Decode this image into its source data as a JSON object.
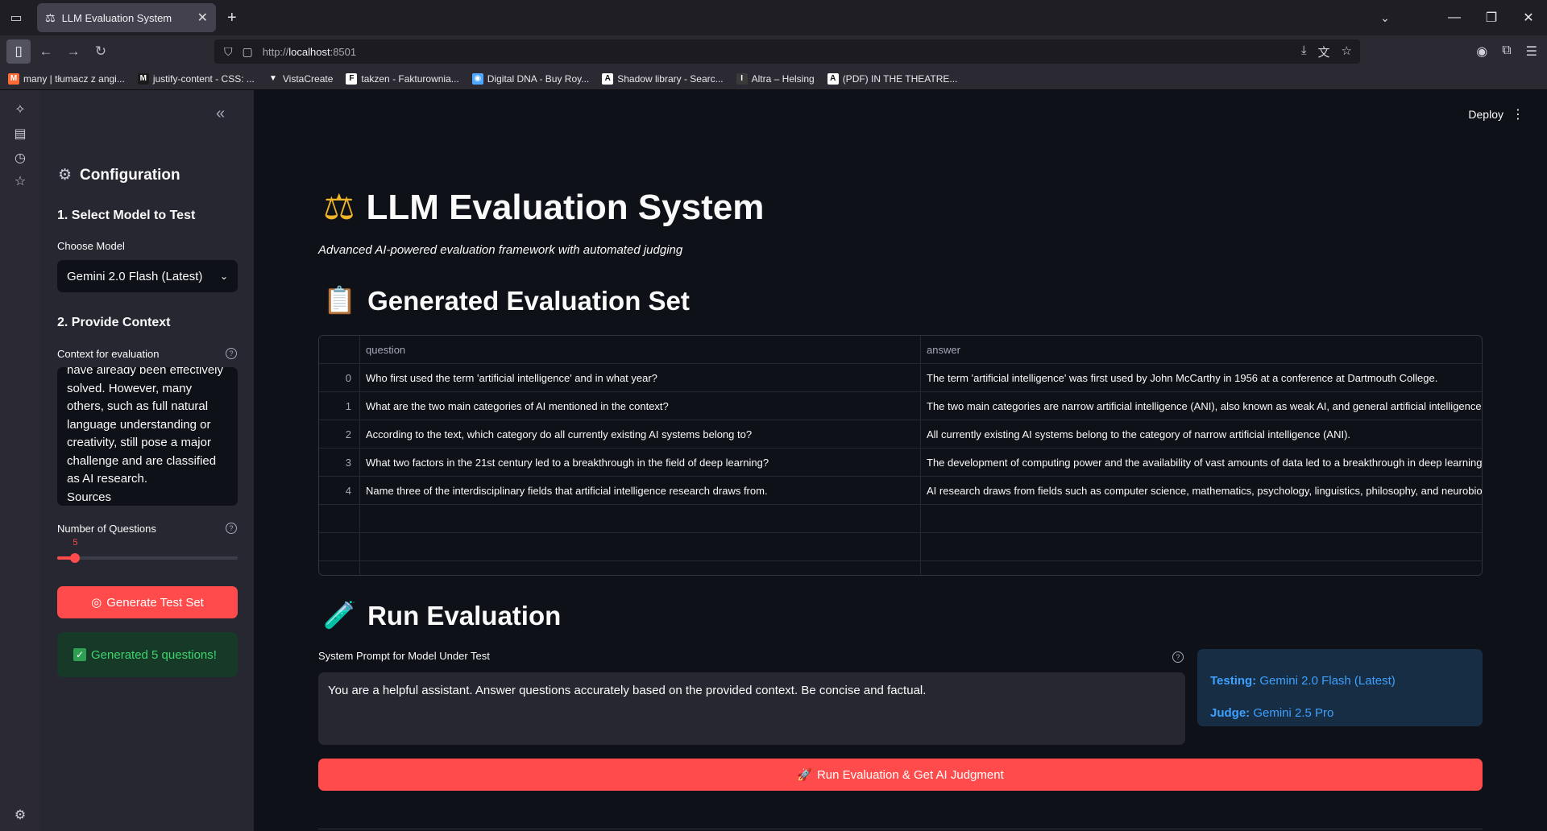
{
  "browser": {
    "tab_title": "LLM Evaluation System",
    "url": "http://localhost:8501",
    "url_prefix": "http://",
    "url_host": "localhost",
    "url_port": ":8501",
    "bookmarks": [
      {
        "label": "many | tłumacz z angi...",
        "icon": "M",
        "color": "#ff6b35"
      },
      {
        "label": "justify-content - CSS: ...",
        "icon": "M",
        "color": "#1b1b1b"
      },
      {
        "label": "VistaCreate",
        "icon": "▼",
        "color": "#2b2a33"
      },
      {
        "label": "takzen - Fakturownia...",
        "icon": "F",
        "color": "#ffffff"
      },
      {
        "label": "Digital DNA - Buy Roy...",
        "icon": "◉",
        "color": "#4fa8ff"
      },
      {
        "label": "Shadow library - Searc...",
        "icon": "A",
        "color": "#ffffff"
      },
      {
        "label": "Altra – Helsing",
        "icon": "I",
        "color": "#3a3a3a"
      },
      {
        "label": "(PDF) IN THE THEATRE...",
        "icon": "A",
        "color": "#ffffff"
      }
    ]
  },
  "sidebar": {
    "title": "Configuration",
    "section1": "1. Select Model to Test",
    "model_label": "Choose Model",
    "model_value": "Gemini 2.0 Flash (Latest)",
    "section2": "2. Provide Context",
    "context_label": "Context for evaluation",
    "context_lines": [
      "have already been effectively",
      "solved. However, many",
      "others, such as full natural",
      "language understanding or",
      "creativity, still pose a major",
      "challenge and are classified",
      "as AI research.",
      "Sources"
    ],
    "questions_label": "Number of Questions",
    "questions_value": "5",
    "questions_fraction": 0.1,
    "generate_button": "Generate Test Set",
    "success_message": "Generated 5 questions!"
  },
  "header": {
    "deploy": "Deploy"
  },
  "main": {
    "title": "LLM Evaluation System",
    "caption": "Advanced AI-powered evaluation framework with automated judging",
    "eval_set_heading": "Generated Evaluation Set",
    "table": {
      "columns": [
        "question",
        "answer"
      ],
      "rows": [
        {
          "index": "0",
          "question": "Who first used the term 'artificial intelligence' and in what year?",
          "answer": "The term 'artificial intelligence' was first used by John McCarthy in 1956 at a conference at Dartmouth College."
        },
        {
          "index": "1",
          "question": "What are the two main categories of AI mentioned in the context?",
          "answer": "The two main categories are narrow artificial intelligence (ANI), also known as weak AI, and general artificial intelligence"
        },
        {
          "index": "2",
          "question": "According to the text, which category do all currently existing AI systems belong to?",
          "answer": "All currently existing AI systems belong to the category of narrow artificial intelligence (ANI)."
        },
        {
          "index": "3",
          "question": "What two factors in the 21st century led to a breakthrough in the field of deep learning?",
          "answer": "The development of computing power and the availability of vast amounts of data led to a breakthrough in deep learning"
        },
        {
          "index": "4",
          "question": "Name three of the interdisciplinary fields that artificial intelligence research draws from.",
          "answer": "AI research draws from fields such as computer science, mathematics, psychology, linguistics, philosophy, and neurobiology"
        }
      ]
    },
    "run_heading": "Run Evaluation",
    "system_prompt_label": "System Prompt for Model Under Test",
    "system_prompt_value": "You are a helpful assistant. Answer questions accurately based on the provided context. Be concise and factual.",
    "testing_label": "Testing:",
    "testing_value": "Gemini 2.0 Flash (Latest)",
    "judge_label": "Judge:",
    "judge_value": "Gemini 2.5 Pro",
    "run_button": "Run Evaluation & Get AI Judgment"
  }
}
